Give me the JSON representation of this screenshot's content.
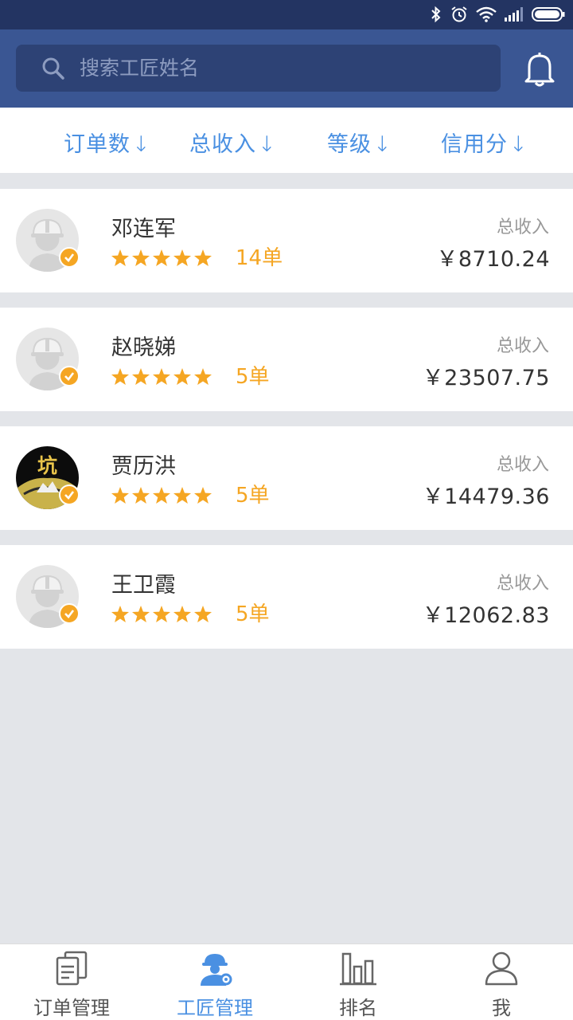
{
  "status_bar": {
    "icons": [
      "bluetooth-icon",
      "alarm-icon",
      "wifi-icon",
      "signal-icon",
      "battery-icon"
    ]
  },
  "search": {
    "placeholder": "搜索工匠姓名"
  },
  "sort_options": [
    {
      "label": "订单数",
      "arrow": "↓"
    },
    {
      "label": "总收入",
      "arrow": "↓"
    },
    {
      "label": "等级",
      "arrow": "↓"
    },
    {
      "label": "信用分",
      "arrow": "↓"
    }
  ],
  "craftsmen": [
    {
      "name": "邓连军",
      "rating": 5,
      "orders": "14单",
      "income_label": "总收入",
      "income": "￥8710.24",
      "avatar": "worker-avatar"
    },
    {
      "name": "赵晓娣",
      "rating": 5,
      "orders": "5单",
      "income_label": "总收入",
      "income": "￥23507.75",
      "avatar": "worker-avatar"
    },
    {
      "name": "贾历洪",
      "rating": 5,
      "orders": "5单",
      "income_label": "总收入",
      "income": "￥14479.36",
      "avatar": "custom-avatar",
      "avatar_text": "坑"
    },
    {
      "name": "王卫霞",
      "rating": 5,
      "orders": "5单",
      "income_label": "总收入",
      "income": "￥12062.83",
      "avatar": "worker-avatar"
    }
  ],
  "tabs": [
    {
      "label": "订单管理",
      "icon": "orders-icon",
      "active": false
    },
    {
      "label": "工匠管理",
      "icon": "craftsman-icon",
      "active": true
    },
    {
      "label": "排名",
      "icon": "ranking-chart-icon",
      "active": false
    },
    {
      "label": "我",
      "icon": "user-icon",
      "active": false
    }
  ],
  "colors": {
    "status_bar": "#233462",
    "header": "#3a5693",
    "search_box": "#2d4275",
    "accent_blue": "#4a90e2",
    "star_orange": "#f5a623",
    "background": "#e3e5e9"
  }
}
